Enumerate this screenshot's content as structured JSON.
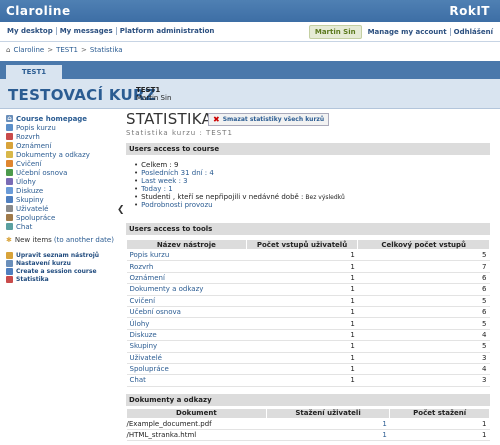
{
  "app": {
    "brand": "Claroline",
    "brand_right": "RokIT"
  },
  "nav": {
    "left": [
      "My desktop",
      "My messages",
      "Platform administration"
    ],
    "user": "Martin Sin",
    "right": [
      "Manage my account",
      "Odhlášení"
    ]
  },
  "breadcrumb": [
    "Claroline",
    "TEST1",
    "Statistika"
  ],
  "course": {
    "tab": "TEST1",
    "title": "TESTOVACÍ KURZ",
    "code": "TEST1",
    "instructor": "Martin Sin"
  },
  "sidebar": {
    "home": "Course homepage",
    "items": [
      {
        "label": "Popis kurzu",
        "icon": "description-icon",
        "color": "#5b8fc9"
      },
      {
        "label": "Rozvrh",
        "icon": "calendar-icon",
        "color": "#c94b4b"
      },
      {
        "label": "Oznámení",
        "icon": "announcement-icon",
        "color": "#d8a33a"
      },
      {
        "label": "Dokumenty a odkazy",
        "icon": "folder-icon",
        "color": "#d8b84a"
      },
      {
        "label": "Cvičení",
        "icon": "exercise-icon",
        "color": "#e0862f"
      },
      {
        "label": "Učební osnova",
        "icon": "learning-path-icon",
        "color": "#4c9a4c"
      },
      {
        "label": "Úlohy",
        "icon": "assignment-icon",
        "color": "#7a6bb5"
      },
      {
        "label": "Diskuze",
        "icon": "forum-icon",
        "color": "#6a9bd8"
      },
      {
        "label": "Skupiny",
        "icon": "groups-icon",
        "color": "#4f7fbf"
      },
      {
        "label": "Uživatelé",
        "icon": "users-icon",
        "color": "#8a8a8a"
      },
      {
        "label": "Spolupráce",
        "icon": "wiki-icon",
        "color": "#a07a4a"
      },
      {
        "label": "Chat",
        "icon": "chat-icon",
        "color": "#5aa0a0"
      }
    ],
    "new_items": "New items",
    "new_items_link": "(to another date)",
    "admin": [
      "Upravit seznam nástrojů",
      "Nastavení kurzu",
      "Create a session course",
      "Statistika"
    ]
  },
  "main": {
    "title": "STATISTIKA",
    "reset": "Smazat statistiky všech kurzů",
    "subtitle": "Statistika kurzu : TEST1",
    "access_head": "Users access to course",
    "access": {
      "total": "Celkem : 9",
      "last31": "Posledních 31 dní : 4",
      "last_week": "Last week : 3",
      "today": "Today : 1",
      "inactive": "Studenti , kteří se nepřipojili v nedávné době :",
      "inactive_result": "Bez výsledků",
      "details": "Podrobnosti provozu"
    },
    "tools_head": "Users access to tools",
    "tools_cols": [
      "Název nástroje",
      "Počet vstupů uživatelů",
      "Celkový počet vstupů"
    ],
    "tools": [
      [
        "Popis kurzu",
        "1",
        "5"
      ],
      [
        "Rozvrh",
        "1",
        "7"
      ],
      [
        "Oznámení",
        "1",
        "6"
      ],
      [
        "Dokumenty a odkazy",
        "1",
        "6"
      ],
      [
        "Cvičení",
        "1",
        "5"
      ],
      [
        "Učební osnova",
        "1",
        "6"
      ],
      [
        "Úlohy",
        "1",
        "5"
      ],
      [
        "Diskuze",
        "1",
        "4"
      ],
      [
        "Skupiny",
        "1",
        "5"
      ],
      [
        "Uživatelé",
        "1",
        "3"
      ],
      [
        "Spolupráce",
        "1",
        "4"
      ],
      [
        "Chat",
        "1",
        "3"
      ]
    ],
    "docs_head": "Dokumenty a odkazy",
    "docs_cols": [
      "Dokument",
      "Stažení uživateli",
      "Počet stažení"
    ],
    "docs": [
      [
        "/Example_document.pdf",
        "1",
        "1"
      ],
      [
        "/HTML_stranka.html",
        "1",
        "1"
      ]
    ]
  }
}
